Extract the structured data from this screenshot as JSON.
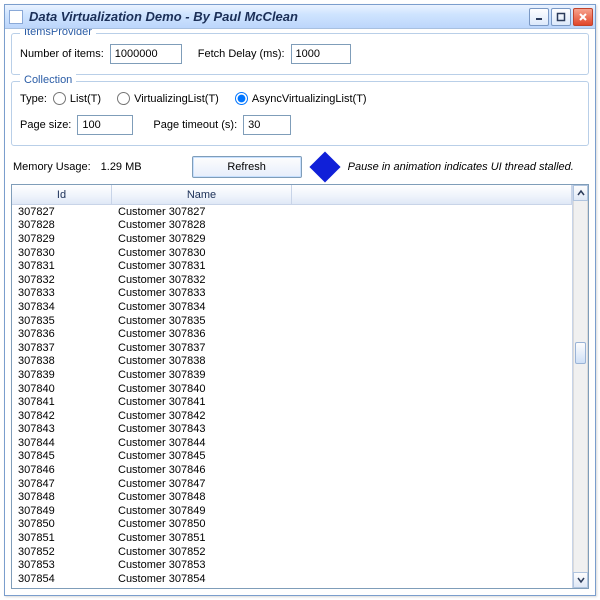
{
  "window": {
    "title": "Data Virtualization Demo - By Paul McClean"
  },
  "itemsProvider": {
    "legend": "ItemsProvider",
    "numItemsLabel": "Number of items:",
    "numItemsValue": "1000000",
    "fetchDelayLabel": "Fetch Delay (ms):",
    "fetchDelayValue": "1000"
  },
  "collection": {
    "legend": "Collection",
    "typeLabel": "Type:",
    "options": {
      "list": "List(T)",
      "virtList": "VirtualizingList(T)",
      "asyncVirtList": "AsyncVirtualizingList(T)"
    },
    "selected": "asyncVirtList",
    "pageSizeLabel": "Page size:",
    "pageSizeValue": "100",
    "pageTimeoutLabel": "Page timeout (s):",
    "pageTimeoutValue": "30"
  },
  "status": {
    "memLabel": "Memory Usage:",
    "memValue": "1.29 MB",
    "refreshLabel": "Refresh",
    "hint": "Pause in animation indicates UI thread stalled."
  },
  "grid": {
    "headers": {
      "id": "Id",
      "name": "Name"
    },
    "rows": [
      {
        "id": "307827",
        "name": "Customer 307827"
      },
      {
        "id": "307828",
        "name": "Customer 307828"
      },
      {
        "id": "307829",
        "name": "Customer 307829"
      },
      {
        "id": "307830",
        "name": "Customer 307830"
      },
      {
        "id": "307831",
        "name": "Customer 307831"
      },
      {
        "id": "307832",
        "name": "Customer 307832"
      },
      {
        "id": "307833",
        "name": "Customer 307833"
      },
      {
        "id": "307834",
        "name": "Customer 307834"
      },
      {
        "id": "307835",
        "name": "Customer 307835"
      },
      {
        "id": "307836",
        "name": "Customer 307836"
      },
      {
        "id": "307837",
        "name": "Customer 307837"
      },
      {
        "id": "307838",
        "name": "Customer 307838"
      },
      {
        "id": "307839",
        "name": "Customer 307839"
      },
      {
        "id": "307840",
        "name": "Customer 307840"
      },
      {
        "id": "307841",
        "name": "Customer 307841"
      },
      {
        "id": "307842",
        "name": "Customer 307842"
      },
      {
        "id": "307843",
        "name": "Customer 307843"
      },
      {
        "id": "307844",
        "name": "Customer 307844"
      },
      {
        "id": "307845",
        "name": "Customer 307845"
      },
      {
        "id": "307846",
        "name": "Customer 307846"
      },
      {
        "id": "307847",
        "name": "Customer 307847"
      },
      {
        "id": "307848",
        "name": "Customer 307848"
      },
      {
        "id": "307849",
        "name": "Customer 307849"
      },
      {
        "id": "307850",
        "name": "Customer 307850"
      },
      {
        "id": "307851",
        "name": "Customer 307851"
      },
      {
        "id": "307852",
        "name": "Customer 307852"
      },
      {
        "id": "307853",
        "name": "Customer 307853"
      },
      {
        "id": "307854",
        "name": "Customer 307854"
      }
    ]
  }
}
